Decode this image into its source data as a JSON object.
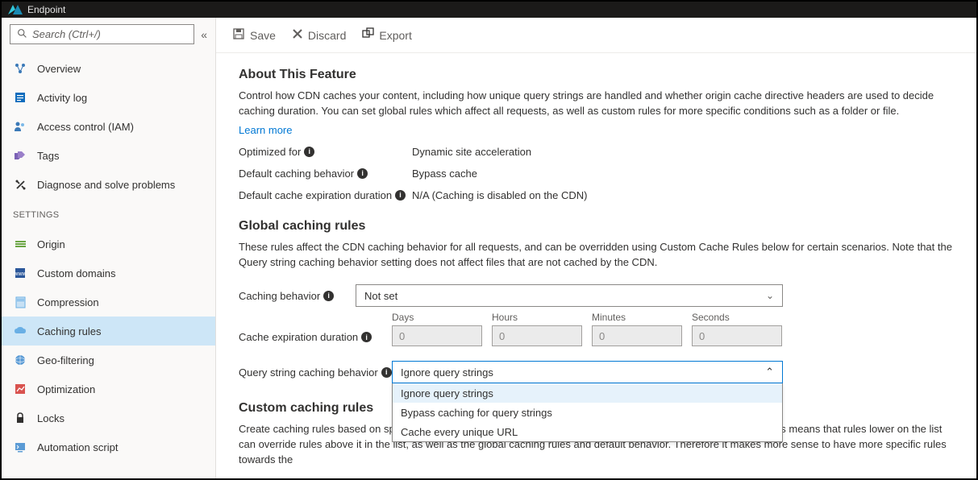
{
  "topbar": {
    "title": "Endpoint"
  },
  "search": {
    "placeholder": "Search (Ctrl+/)"
  },
  "coreNav": [
    {
      "label": "Overview",
      "icon": "overview",
      "color": "#3b79b7"
    },
    {
      "label": "Activity log",
      "icon": "activity",
      "color": "#0f6cbd"
    },
    {
      "label": "Access control (IAM)",
      "icon": "iam",
      "color": "#3b79b7"
    },
    {
      "label": "Tags",
      "icon": "tags",
      "color": "#7b61b5"
    },
    {
      "label": "Diagnose and solve problems",
      "icon": "diagnose",
      "color": "#323130"
    }
  ],
  "settingsHeader": "SETTINGS",
  "settingsNav": [
    {
      "label": "Origin",
      "icon": "origin",
      "color": "#6ba644"
    },
    {
      "label": "Custom domains",
      "icon": "domains",
      "color": "#2b579a"
    },
    {
      "label": "Compression",
      "icon": "compression",
      "color": "#69afe5"
    },
    {
      "label": "Caching rules",
      "icon": "caching",
      "color": "#3b79b7",
      "active": true
    },
    {
      "label": "Geo-filtering",
      "icon": "geo",
      "color": "#5b9bd5"
    },
    {
      "label": "Optimization",
      "icon": "optimization",
      "color": "#d9534f"
    },
    {
      "label": "Locks",
      "icon": "locks",
      "color": "#323130"
    },
    {
      "label": "Automation script",
      "icon": "automation",
      "color": "#5b9bd5"
    }
  ],
  "cmdbar": {
    "save": "Save",
    "discard": "Discard",
    "export": "Export"
  },
  "about": {
    "title": "About This Feature",
    "text": "Control how CDN caches your content, including how unique query strings are handled and whether origin cache directive headers are used to decide caching duration. You can set global rules which affect all requests, as well as custom rules for more specific conditions such as a folder or file.",
    "learn": "Learn more",
    "rows": [
      {
        "label": "Optimized for",
        "value": "Dynamic site acceleration"
      },
      {
        "label": "Default caching behavior",
        "value": "Bypass cache"
      },
      {
        "label": "Default cache expiration duration",
        "value": "N/A (Caching is disabled on the CDN)"
      }
    ]
  },
  "global": {
    "title": "Global caching rules",
    "text": "These rules affect the CDN caching behavior for all requests, and can be overridden using Custom Cache Rules below for certain scenarios. Note that the Query string caching behavior setting does not affect files that are not cached by the CDN.",
    "cachingBehaviorLabel": "Caching behavior",
    "cachingBehaviorValue": "Not set",
    "expirationLabel": "Cache expiration duration",
    "duration": {
      "daysLabel": "Days",
      "days": "0",
      "hoursLabel": "Hours",
      "hours": "0",
      "minutesLabel": "Minutes",
      "minutes": "0",
      "secondsLabel": "Seconds",
      "seconds": "0"
    },
    "qsLabel": "Query string caching behavior",
    "qsValue": "Ignore query strings",
    "qsOptions": [
      "Ignore query strings",
      "Bypass caching for query strings",
      "Cache every unique URL"
    ]
  },
  "custom": {
    "title": "Custom caching rules",
    "text": "Create caching rules based on specific match conditions. These rules will be evaluated in order from top to down. This means that rules lower on the list can override rules above it in the list, as well as the global caching rules and default behavior. Therefore it makes more sense to have more specific rules towards the"
  }
}
